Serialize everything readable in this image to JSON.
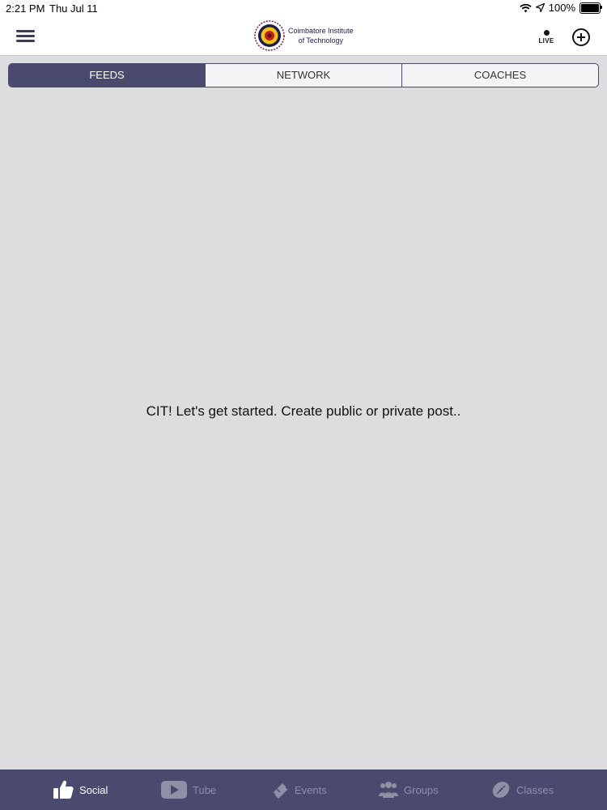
{
  "status": {
    "time": "2:21 PM",
    "date": "Thu Jul 11",
    "battery": "100%"
  },
  "header": {
    "logo_line1": "Coimbatore Institute",
    "logo_line2": "of Technology",
    "live_label": "LIVE"
  },
  "tabs": [
    {
      "label": "FEEDS",
      "active": true
    },
    {
      "label": "NETWORK",
      "active": false
    },
    {
      "label": "COACHES",
      "active": false
    }
  ],
  "main": {
    "empty_message": "CIT! Let's get started. Create public or private post.."
  },
  "tabbar": [
    {
      "label": "Social",
      "icon": "thumbs-up-icon",
      "active": true
    },
    {
      "label": "Tube",
      "icon": "play-icon",
      "active": false
    },
    {
      "label": "Events",
      "icon": "ticket-icon",
      "active": false
    },
    {
      "label": "Groups",
      "icon": "group-icon",
      "active": false
    },
    {
      "label": "Classes",
      "icon": "ball-icon",
      "active": false
    }
  ],
  "colors": {
    "accent": "#4a4a6e",
    "background": "#dddcdf",
    "inactive_tab": "#8f8fa6"
  }
}
